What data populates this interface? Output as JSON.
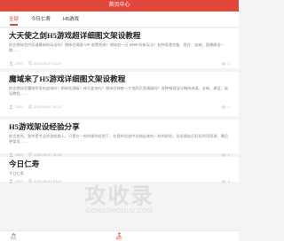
{
  "header": {
    "title": "首页中心"
  },
  "tabs": [
    {
      "label": "全部",
      "active": true
    },
    {
      "label": "今日仁寿",
      "active": false
    },
    {
      "label": "H5游戏",
      "active": false
    }
  ],
  "articles": [
    {
      "title": "大天使之剑H5游戏超详细图文架设教程",
      "desc": "前言想体验传奇道最新的玩法吗？想体验满屏 VIP 收费系统？想体验一万 9999 的新玩法？各种奇遇完备、提升、攻城，直播建设一路……",
      "user": "CEO",
      "date": "2022-06-27 11:27",
      "views": "1"
    },
    {
      "title": "魔域来了H5游戏详细图文架设教程",
      "desc": "前言想体验魔域传奇的战场吗？想体验满级？神兵变态吗？想体验神兽一大批的页游满级吗？各种畅游战斗畅快淋漓、全新、建设、架设教程……",
      "user": "CEO",
      "date": "2022-06-27 11:11",
      "views": "1"
    },
    {
      "title": "H5游戏架设经验分享",
      "desc": "前言首先，我并是专业的游戏商人，只是在一些的操作经验下，在我的实战中总结出来的一些的经验，告诉朋友们好好利用资源，最后更架设……",
      "user": "CEO",
      "date": "2022-06-27 11:10",
      "views": "1"
    },
    {
      "title": "今日仁寿",
      "desc": "今日仁寿",
      "user": "CEO",
      "date": "2022-06-27 07:47",
      "views": "1"
    }
  ],
  "watermark": {
    "main": "攻收录",
    "sub": "GONGSHOULU.COM"
  },
  "bottom_nav": {
    "home_label": "首页",
    "me_label": "我的"
  },
  "colors": {
    "accent": "#e0483c"
  }
}
